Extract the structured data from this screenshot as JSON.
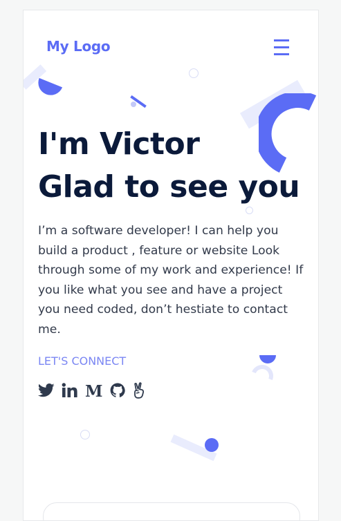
{
  "header": {
    "logo_text": "My Logo",
    "menu_icon": "hamburger-menu-icon"
  },
  "hero": {
    "heading_line1": "I'm Victor",
    "heading_line2": "Glad to see you",
    "description": "I’m a software developer! I can help you build a product , feature or website Look through some of my work and experience! If you like what you see and have a project you need coded, don’t hestiate to contact me.",
    "connect_label": "LET'S CONNECT"
  },
  "socials": [
    {
      "icon": "twitter-icon"
    },
    {
      "icon": "linkedin-icon"
    },
    {
      "icon": "medium-icon"
    },
    {
      "icon": "github-icon"
    },
    {
      "icon": "peace-hand-icon"
    }
  ],
  "colors": {
    "accent": "#5b6cf5",
    "accent_light": "#e9ecfd",
    "heading": "#0b1a3a",
    "body_text": "#323a4a",
    "connect": "#7a86f3",
    "social_icons": "#2f3a4d"
  }
}
